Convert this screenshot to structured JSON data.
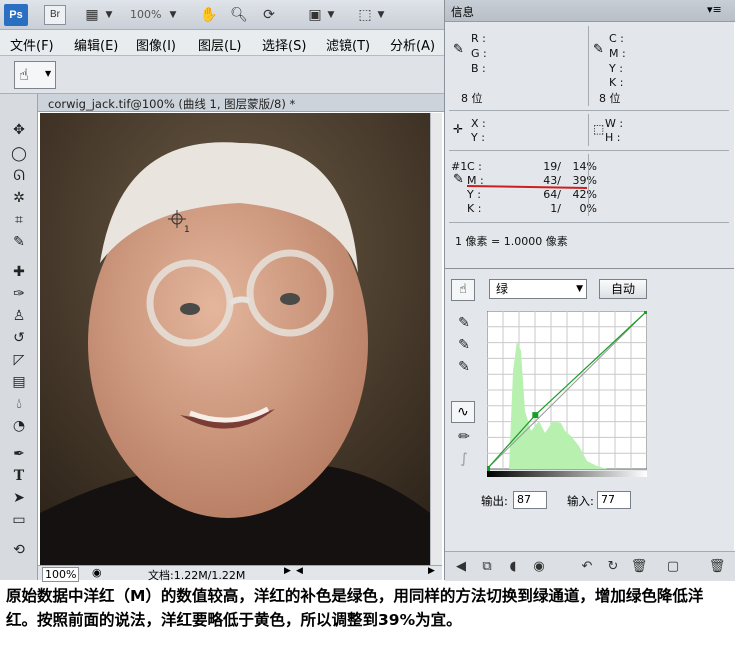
{
  "app": {
    "logo": "Ps",
    "bridge_label": "Br",
    "zoom": "100%"
  },
  "menu": [
    "文件(F)",
    "编辑(E)",
    "图像(I)",
    "图层(L)",
    "选择(S)",
    "滤镜(T)",
    "分析(A)"
  ],
  "document": {
    "tab_title": "corwig_jack.tif@100% (曲线 1, 图层蒙版/8) *",
    "zoom": "100%",
    "status": "文档:1.22M/1.22M",
    "sampler_label": "1"
  },
  "info_panel": {
    "title": "信息",
    "r_label": "R :",
    "g_label": "G :",
    "b_label": "B :",
    "bitdepth_left": "8 位",
    "c_label": "C :",
    "m_label": "M :",
    "y_label": "Y :",
    "k_label": "K :",
    "bitdepth_right": "8 位",
    "x_label": "X :",
    "y_pos_label": "Y :",
    "w_label": "W :",
    "h_label": "H :",
    "sample_id": "#1",
    "sample_rows": [
      {
        "label": "C :",
        "before": "19/",
        "after": "14%"
      },
      {
        "label": "M :",
        "before": "43/",
        "after": "39%"
      },
      {
        "label": "Y :",
        "before": "64/",
        "after": "42%"
      },
      {
        "label": "K :",
        "before": "1/",
        "after": "0%"
      }
    ],
    "pixel_ratio": "1 像素 = 1.0000 像素"
  },
  "adjustments": {
    "channel": "绿",
    "auto_label": "自动",
    "output_label": "输出:",
    "output_value": "87",
    "input_label": "输入:",
    "input_value": "77",
    "curve_points": [
      [
        0,
        0
      ],
      [
        77,
        87
      ],
      [
        255,
        255
      ]
    ]
  },
  "caption": "原始数据中洋红（M）的数值较高，洋红的补色是绿色，用同样的方法切换到绿通道，增加绿色降低洋红。按照前面的说法，洋红要略低于黄色，所以调整到39%为宜。",
  "colors": {
    "annotation_line": "#cc1f1f",
    "curve": "#1a9e2a",
    "histogram": "#b8f0b0"
  }
}
